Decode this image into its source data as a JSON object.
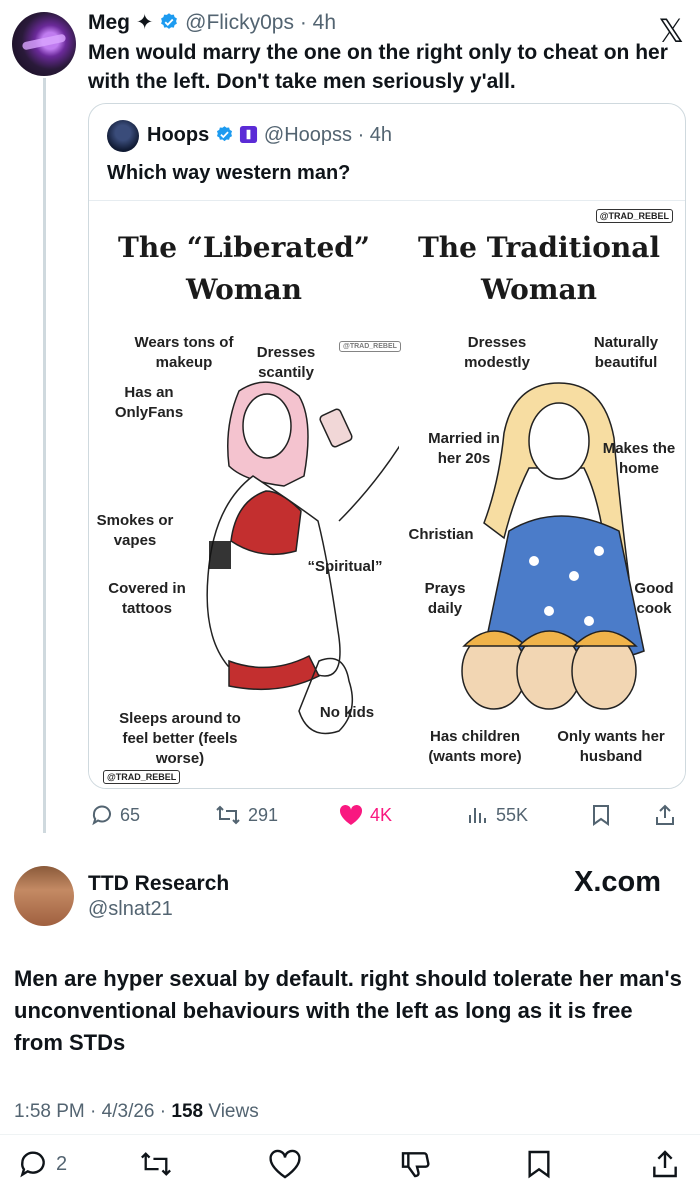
{
  "top_post": {
    "name": "Meg ✦",
    "handle": "@Flicky0ps",
    "time": "· 4h",
    "text": "Men would marry the one on the right only to cheat on her with the left. Don't take men seriously y'all.",
    "x_logo": "𝕏"
  },
  "quote": {
    "name": "Hoops",
    "handle": "@Hoopss",
    "time": "· 4h",
    "text": "Which way western man?",
    "meme": {
      "watermark": "@TRAD_REBEL",
      "left_title": "The “Liberated” Woman",
      "right_title": "The Traditional Woman",
      "left_labels": {
        "makeup": "Wears tons of makeup",
        "dresses": "Dresses scantily",
        "onlyfans": "Has an OnlyFans",
        "smokes": "Smokes or vapes",
        "spiritual": "“Spiritual”",
        "tattoos": "Covered in tattoos",
        "nokids": "No kids",
        "sleeps": "Sleeps around to feel better (feels worse)"
      },
      "right_labels": {
        "modest": "Dresses modestly",
        "beautiful": "Naturally beautiful",
        "married": "Married in her 20s",
        "home": "Makes the home",
        "christian": "Christian",
        "prays": "Prays daily",
        "cook": "Good cook",
        "children": "Has children (wants more)",
        "husband": "Only wants her husband"
      }
    }
  },
  "stats": {
    "replies": "65",
    "reposts": "291",
    "likes": "4K",
    "views": "55K"
  },
  "reply": {
    "name": "TTD Research",
    "handle": "@slnat21",
    "site": "X.com",
    "text": "Men are hyper sexual by default. right should tolerate her man's unconventional behaviours with the left as long as it is free from STDs",
    "time": "1:58 PM",
    "date": "4/3/26",
    "views_count": "158",
    "views_label": "Views",
    "replies": "2"
  },
  "colors": {
    "accent": "#1d9bf0",
    "like": "#f91880",
    "muted": "#536471"
  }
}
